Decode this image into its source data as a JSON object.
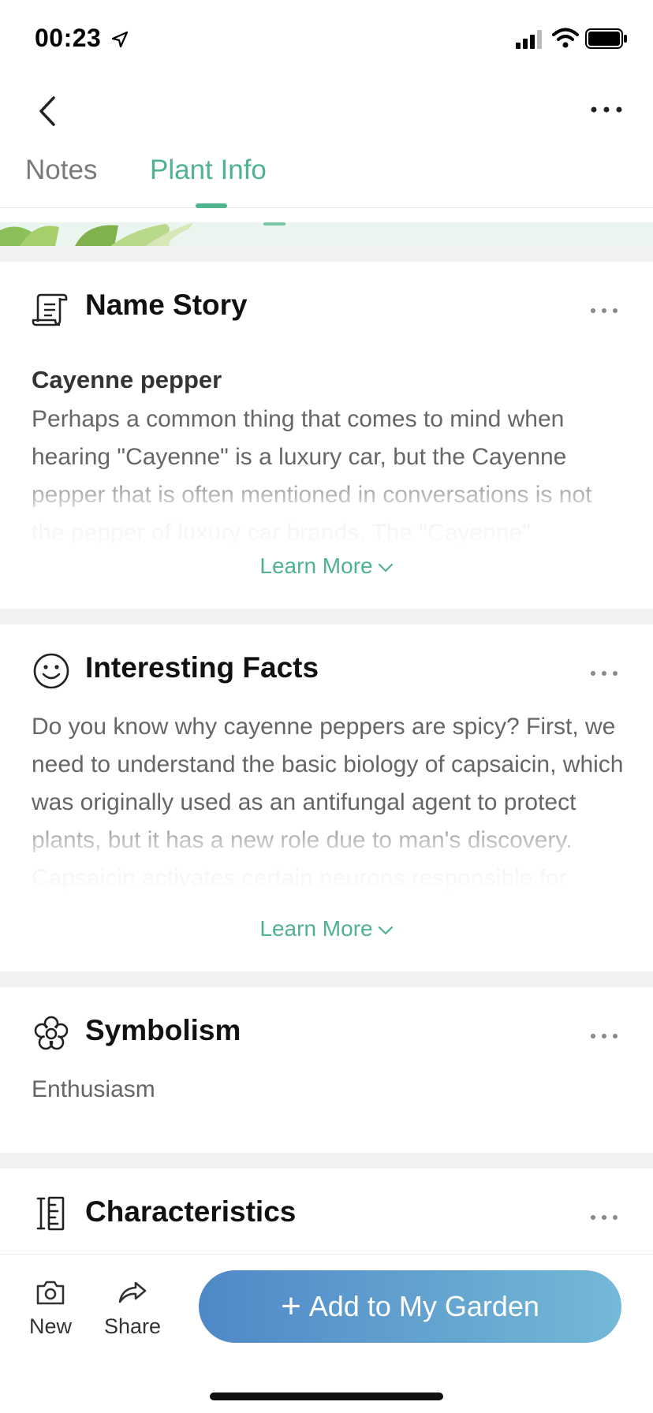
{
  "status_bar": {
    "time": "00:23"
  },
  "tabs": [
    {
      "label": "Notes",
      "active": false
    },
    {
      "label": "Plant Info",
      "active": true
    }
  ],
  "colors": {
    "accent": "#4fb38d",
    "button_start": "#4f88c8",
    "button_end": "#74b9d6"
  },
  "sections": {
    "name_story": {
      "title": "Name Story",
      "icon": "scroll-icon",
      "subtitle": "Cayenne pepper",
      "body": "Perhaps a common thing that comes to mind when hearing \"Cayenne\" is a luxury car, but the Cayenne pepper that is often mentioned in conversations is not the pepper of luxury car brands. The \"Cayenne\"",
      "learn_more": "Learn More"
    },
    "interesting_facts": {
      "title": "Interesting Facts",
      "icon": "smile-icon",
      "body": "Do you know why cayenne peppers are spicy? First, we need to understand the basic biology of capsaicin, which was originally used as an antifungal agent to protect plants, but it has a new role due to man's discovery. Capsaicin activates certain neurons responsible for pain. Whether the cells are",
      "learn_more": "Learn More"
    },
    "symbolism": {
      "title": "Symbolism",
      "icon": "flower-icon",
      "body": "Enthusiasm"
    },
    "characteristics": {
      "title": "Characteristics",
      "icon": "ruler-icon"
    }
  },
  "bottom_bar": {
    "new_label": "New",
    "share_label": "Share",
    "add_label": "Add to My Garden"
  }
}
